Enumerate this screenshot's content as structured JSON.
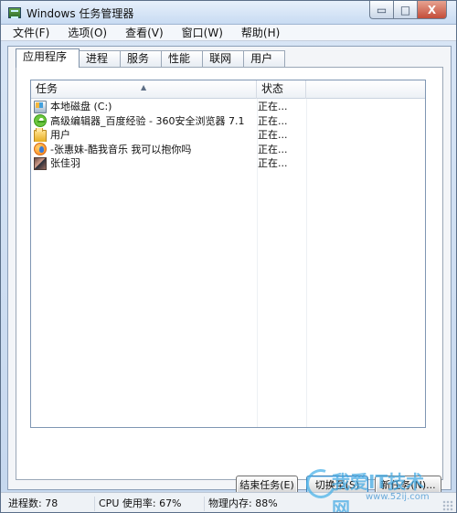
{
  "window": {
    "title": "Windows 任务管理器",
    "controls": {
      "minimize": "▭",
      "maximize": "□",
      "close": "X"
    }
  },
  "menu": [
    {
      "label": "文件(F)"
    },
    {
      "label": "选项(O)"
    },
    {
      "label": "查看(V)"
    },
    {
      "label": "窗口(W)"
    },
    {
      "label": "帮助(H)"
    }
  ],
  "tabs": [
    {
      "label": "应用程序",
      "active": true
    },
    {
      "label": "进程",
      "active": false
    },
    {
      "label": "服务",
      "active": false
    },
    {
      "label": "性能",
      "active": false
    },
    {
      "label": "联网",
      "active": false
    },
    {
      "label": "用户",
      "active": false
    }
  ],
  "table": {
    "headers": {
      "task": "任务",
      "status": "状态"
    },
    "rows": [
      {
        "icon": "drive-icon",
        "task": "本地磁盘 (C:)",
        "status": "正在..."
      },
      {
        "icon": "browser-icon",
        "task": "高级编辑器_百度经验 - 360安全浏览器 7.1",
        "status": "正在..."
      },
      {
        "icon": "folder-icon",
        "task": "用户",
        "status": "正在..."
      },
      {
        "icon": "music-icon",
        "task": "-张惠妹-酷我音乐 我可以抱你吗",
        "status": "正在..."
      },
      {
        "icon": "photo-icon",
        "task": "张佳羽",
        "status": "正在..."
      }
    ]
  },
  "buttons": {
    "end_task": "结束任务(E)",
    "switch_to": "切换至(S)",
    "new_task": "新任务(N)..."
  },
  "statusbar": {
    "processes": "进程数: 78",
    "cpu": "CPU 使用率: 67%",
    "memory": "物理内存: 88%"
  },
  "watermark": {
    "main": "我爱IT技术网",
    "sub": "www.52ij.com"
  }
}
